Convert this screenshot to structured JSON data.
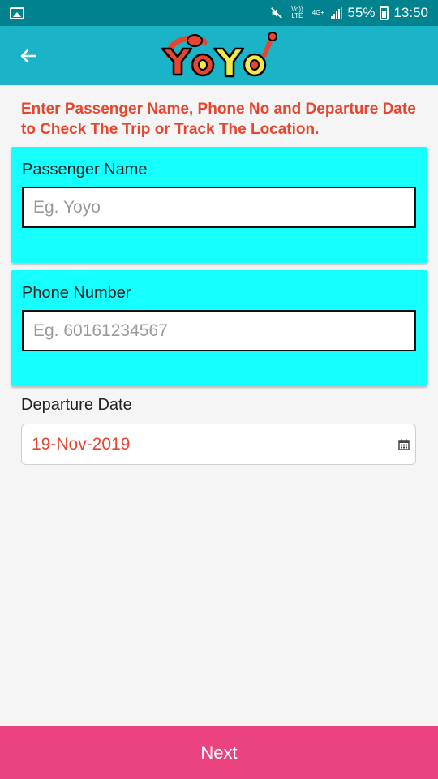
{
  "status_bar": {
    "volte": "Vo)) LTE",
    "network": "4G+",
    "battery": "55%",
    "time": "13:50"
  },
  "app_bar": {
    "logo_text": "YOYO"
  },
  "instruction": "Enter Passenger Name, Phone No and Departure Date to Check The Trip or Track The Location.",
  "passenger": {
    "label": "Passenger Name",
    "placeholder": "Eg. Yoyo"
  },
  "phone": {
    "label": "Phone Number",
    "placeholder": "Eg. 60161234567"
  },
  "departure": {
    "label": "Departure Date",
    "value": "19-Nov-2019"
  },
  "next_label": "Next",
  "colors": {
    "status_bar": "#00838f",
    "app_bar": "#1bb3c8",
    "instruction": "#e8452e",
    "card": "#15ffff",
    "next_button": "#ea4380"
  },
  "icons": [
    "gallery-icon",
    "mute-icon",
    "signal-icon",
    "battery-icon",
    "back-arrow-icon",
    "calendar-icon"
  ]
}
